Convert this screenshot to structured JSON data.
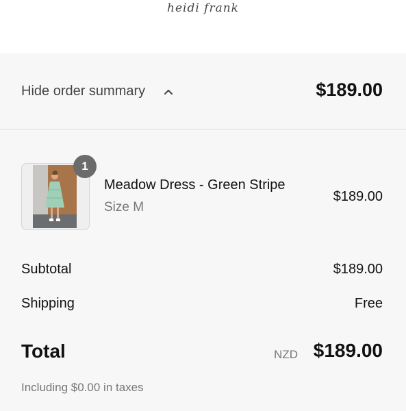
{
  "header": {
    "logo_text": "heidi frank"
  },
  "summary_toggle": {
    "label": "Hide order summary",
    "total": "$189.00",
    "icon": "chevron-up-icon"
  },
  "line_items": [
    {
      "quantity": "1",
      "name": "Meadow Dress - Green Stripe",
      "variant": "Size M",
      "price": "$189.00"
    }
  ],
  "costs": {
    "subtotal_label": "Subtotal",
    "subtotal_value": "$189.00",
    "shipping_label": "Shipping",
    "shipping_value": "Free"
  },
  "total": {
    "label": "Total",
    "currency": "NZD",
    "value": "$189.00",
    "tax_note": "Including $0.00 in taxes"
  },
  "colors": {
    "panel_bg": "#f7f7f7",
    "badge_bg": "#6b6b6b",
    "divider": "#dcdcdc"
  }
}
